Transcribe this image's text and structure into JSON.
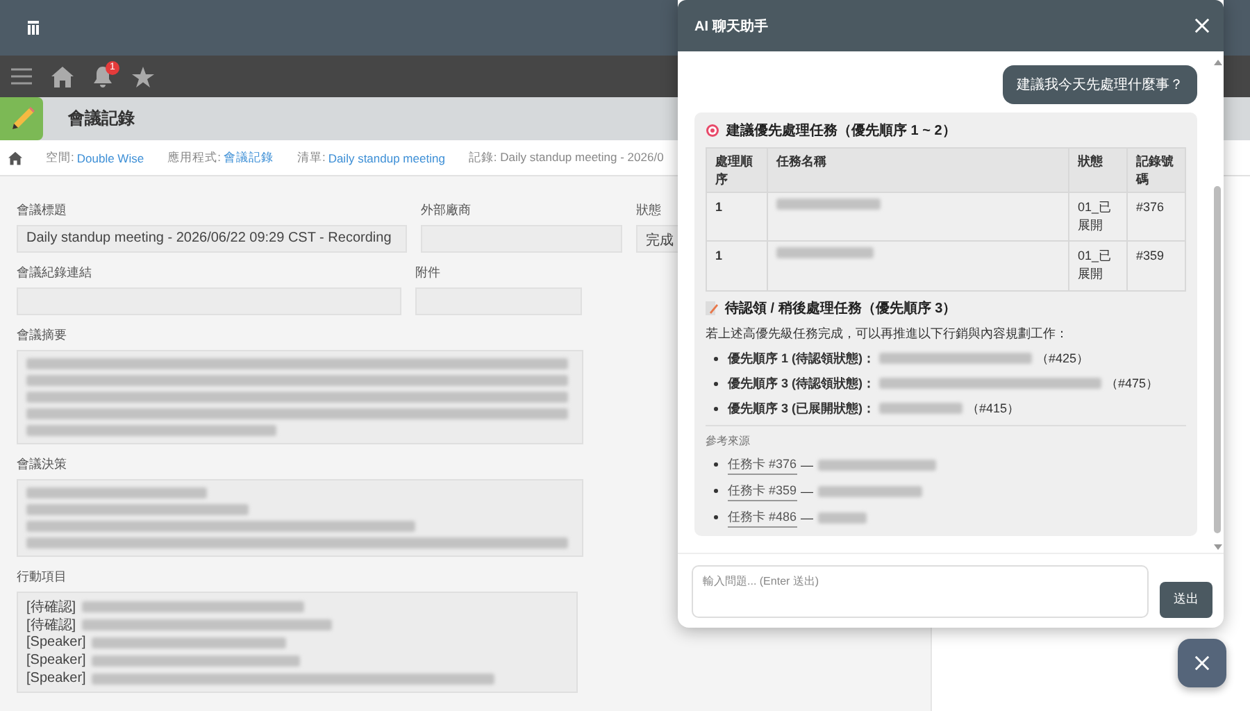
{
  "nav": {
    "notification_count": "1"
  },
  "app": {
    "title": "會議記錄"
  },
  "breadcrumbs": [
    {
      "label": "空間:",
      "value": "Double Wise"
    },
    {
      "label": "應用程式:",
      "value": "會議記錄"
    },
    {
      "label": "清單:",
      "value": "Daily standup meeting"
    },
    {
      "label": "記錄: Daily standup meeting - 2026/0"
    }
  ],
  "form": {
    "title_field": {
      "label": "會議標題",
      "value": "Daily standup meeting - 2026/06/22 09:29 CST - Recording"
    },
    "vendor_field": {
      "label": "外部廠商"
    },
    "status_field": {
      "label": "狀態",
      "value": "完成"
    },
    "link_field": {
      "label": "會議紀錄連結"
    },
    "attachment_field": {
      "label": "附件"
    },
    "summary": {
      "label": "會議摘要"
    },
    "decisions": {
      "label": "會議決策"
    },
    "actions": {
      "label": "行動項目",
      "items": [
        {
          "tag": "[待確認]"
        },
        {
          "tag": "[待確認]"
        },
        {
          "tag": "[Speaker]"
        },
        {
          "tag": "[Speaker]"
        },
        {
          "tag": "[Speaker]"
        }
      ]
    }
  },
  "chat": {
    "title": "AI 聊天助手",
    "user_message": "建議我今天先處理什麼事？",
    "priority_section": {
      "heading": "建議優先處理任務（優先順序 1 ~ 2）",
      "columns": [
        "處理順序",
        "任務名稱",
        "狀態",
        "記錄號碼"
      ],
      "rows": [
        {
          "order": "1",
          "status": "01_已展開",
          "record": "#376"
        },
        {
          "order": "1",
          "status": "01_已展開",
          "record": "#359"
        }
      ]
    },
    "later_section": {
      "heading": "待認領 / 稍後處理任務（優先順序 3）",
      "intro": "若上述高優先級任務完成，可以再推進以下行銷與內容規劃工作：",
      "items": [
        {
          "label": "優先順序 1 (待認領狀態)：",
          "ref": "（#425）"
        },
        {
          "label": "優先順序 3 (待認領狀態)：",
          "ref": "（#475）"
        },
        {
          "label": "優先順序 3 (已展開狀態)：",
          "ref": "（#415）"
        }
      ]
    },
    "sources": {
      "heading": "參考來源",
      "items": [
        {
          "link": "任務卡 #376",
          "dash": "—"
        },
        {
          "link": "任務卡 #359",
          "dash": "—"
        },
        {
          "link": "任務卡 #486",
          "dash": "—"
        }
      ]
    },
    "input": {
      "placeholder": "輸入問題... (Enter 送出)"
    },
    "send_button": "送出"
  }
}
